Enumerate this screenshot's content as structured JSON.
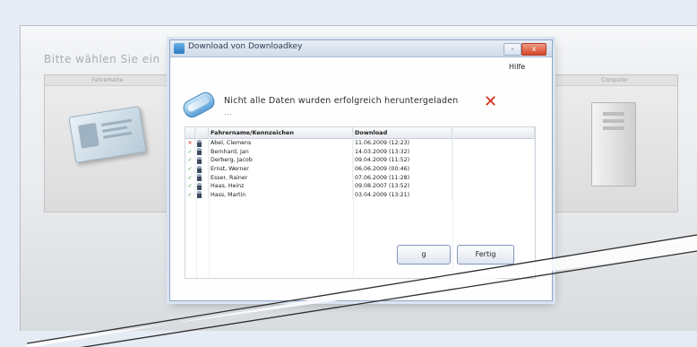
{
  "prompt": "Bitte wählen Sie ein",
  "cards": {
    "left_title": "Fahrerkarte",
    "right_title": "Computer"
  },
  "dialog": {
    "title": "Download von Downloadkey",
    "help_menu": "Hilfe",
    "message": "Nicht alle Daten wurden erfolgreich heruntergeladen",
    "message_sub": "...",
    "columns": [
      "Fahrername/Kennzeichen",
      "Download"
    ],
    "rows": [
      {
        "status": "error",
        "name": "Abel, Clemens",
        "download": "11.06.2009 (12:23)"
      },
      {
        "status": "ok",
        "name": "Bernhard, Jan",
        "download": "14.03.2009 (13:32)"
      },
      {
        "status": "ok",
        "name": "Derberg, Jacob",
        "download": "09.04.2009 (11:52)"
      },
      {
        "status": "ok",
        "name": "Ernst, Werner",
        "download": "06.06.2009 (00:46)"
      },
      {
        "status": "ok",
        "name": "Esser, Rainer",
        "download": "07.06.2009 (11:28)"
      },
      {
        "status": "ok",
        "name": "Haas, Heinz",
        "download": "09.08.2007 (13:52)"
      },
      {
        "status": "ok",
        "name": "Hass, Martin",
        "download": "03.04.2009 (13:21)"
      }
    ],
    "buttons": {
      "left_label": "g",
      "fertig_label": "Fertig"
    },
    "win_controls": {
      "minimize": "-",
      "close": "x"
    }
  },
  "colors": {
    "error": "#d42e1a",
    "ok": "#2f9a2f",
    "accent": "#2a7ac4"
  }
}
